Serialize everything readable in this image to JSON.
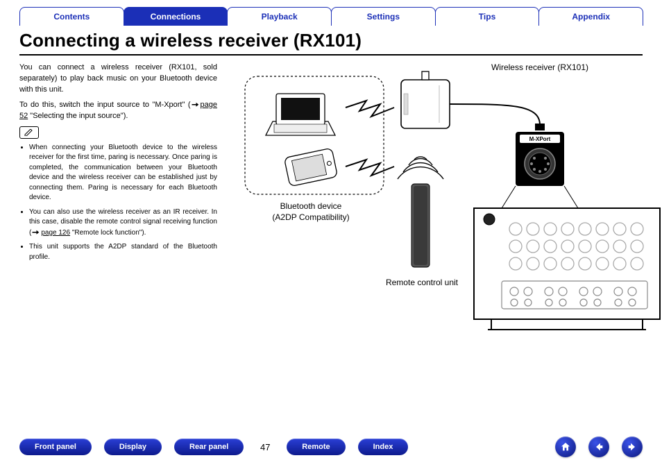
{
  "tabs": {
    "items": [
      {
        "label": "Contents",
        "active": false
      },
      {
        "label": "Connections",
        "active": true
      },
      {
        "label": "Playback",
        "active": false
      },
      {
        "label": "Settings",
        "active": false
      },
      {
        "label": "Tips",
        "active": false
      },
      {
        "label": "Appendix",
        "active": false
      }
    ]
  },
  "title": "Connecting a wireless receiver (RX101)",
  "intro": {
    "p1": "You can connect a wireless receiver (RX101, sold separately) to play back music on your Bluetooth device with this unit.",
    "p2a": "To do this, switch the input source to \"M-Xport\" (",
    "p2_linktext": "page 52",
    "p2b": " \"Selecting the input source\")."
  },
  "notes": {
    "b1": "When connecting your Bluetooth device to the wireless receiver for the first time, paring is necessary. Once paring is completed, the communication between your Bluetooth device and the wireless receiver can be established just by connecting them. Paring is necessary for each Bluetooth device.",
    "b2a": "You can also use the wireless receiver as an IR receiver. In this case, disable the remote control signal receiving function (",
    "b2_linktext": "page 126",
    "b2b": " \"Remote lock function\").",
    "b3": "This unit supports the A2DP standard of the Bluetooth profile."
  },
  "diagram": {
    "wireless_label": "Wireless receiver (RX101)",
    "bluetooth_label_l1": "Bluetooth device",
    "bluetooth_label_l2": "(A2DP Compatibility)",
    "remote_label": "Remote control unit",
    "mxport_label": "M-XPort"
  },
  "footer": {
    "front": "Front panel",
    "display": "Display",
    "rear": "Rear panel",
    "page": "47",
    "remote": "Remote",
    "index": "Index"
  }
}
